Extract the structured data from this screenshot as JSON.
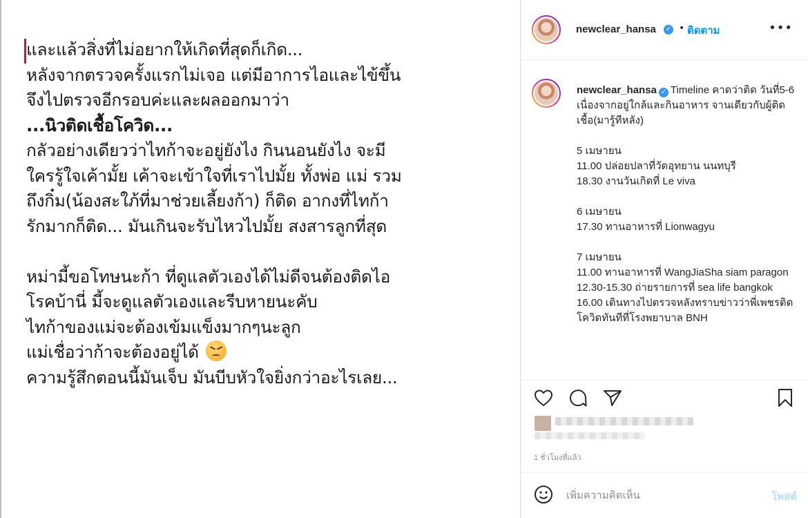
{
  "post": {
    "line1": "และแล้วสิ่งที่ไม่อยากให้เกิดที่สุดก็เกิด...",
    "line2": "หลังจากตรวจครั้งแรกไม่เจอ แต่มีอาการไอและไข้ขึ้น",
    "line3": "จึงไปตรวจอีกรอบค่ะและผลออกมาว่า",
    "line4": "...นิวติดเชื้อโควิด...",
    "line5": "กลัวอย่างเดียวว่าไทก้าจะอยู่ยังไง กินนอนยังไง จะมี",
    "line6": "ใครรู้ใจเค้ามั้ย เค้าจะเข้าใจที่เราไปมั้ย  ทั้งพ่อ แม่ รวม",
    "line7": "ถึงกิ๋ม(น้องสะใภ้ที่มาช่วยเลี้ยงก้า) ก็ติด อากงที่ไทก้า",
    "line8": "รักมากก็ติด... มันเกินจะรับไหวไปมั้ย สงสารลูกที่สุด",
    "line9": "หม่ามี้ขอโทษนะก้า ที่ดูแลตัวเองได้ไม่ดีจนต้องติดไอ",
    "line10": "โรคบ้านี่ มี้จะดูแลตัวเองและรีบหายนะคับ",
    "line11": "ไทก้าของแม่จะต้องเข้มแข็งมากๆนะลูก",
    "line12": "แม่เชื่อว่าก้าจะต้องอยู่ได้",
    "line13": "ความรู้สึกตอนนี้มันเจ็บ มันบีบหัวใจยิ่งกว่าอะไรเลย..."
  },
  "header": {
    "username": "newclear_hansa",
    "follow_label": "ติดตาม",
    "dot": "•",
    "more": "•••"
  },
  "caption": {
    "username": "newclear_hansa",
    "intro": "Timeline คาดว่าติด วันที่5-6 เนื่องจากอยู่ใกล้และกินอาหาร จานเดียวกับผู้ติดเชื้อ(มารู้ทีหลัง)",
    "day1_title": "5 เมษายน",
    "day1_a": "11.00 ปล่อยปลาที่วัดอุทยาน นนทบุรี",
    "day1_b": "18.30 งานวันเกิดที่ Le viva",
    "day2_title": "6 เมษายน",
    "day2_a": "17.30 ทานอาหารที่ Lionwagyu",
    "day3_title": "7 เมษายน",
    "day3_a": "11.00 ทานอาหารที่ WangJiaSha siam paragon",
    "day3_b": "12.30-15.30 ถ่ายรายการที่ sea life bangkok",
    "day3_c": "16.00 เดินทางไปตรวจหลังทราบข่าวว่าพี่เพชรติดโควิดทันทีที่โรงพยาบาล BNH"
  },
  "meta": {
    "time_ago": "1 ชั่วโมงที่แล้ว"
  },
  "comment": {
    "placeholder": "เพิ่มความคิดเห็น",
    "post_label": "โพสต์"
  },
  "icons": {
    "like": "heart-icon",
    "comment": "comment-icon",
    "share": "share-icon",
    "save": "bookmark-icon",
    "emoji": "emoji-icon",
    "more": "more-icon",
    "verified": "verified-icon"
  },
  "colors": {
    "accent": "#0095f6",
    "verified": "#3897f0",
    "post_disabled": "#b2dffc",
    "muted": "#8e8e8e",
    "red_bar": "#b3242f"
  }
}
